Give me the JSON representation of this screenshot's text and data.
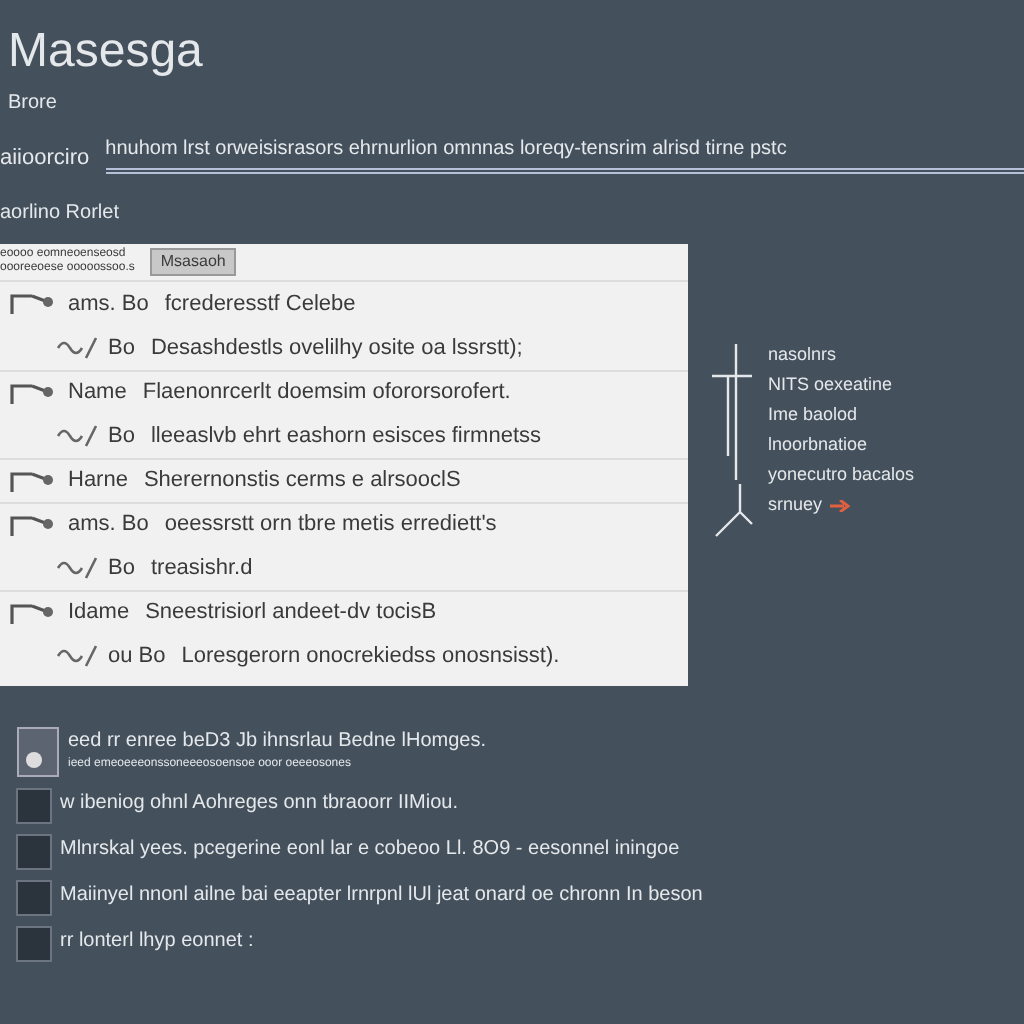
{
  "title": "Masesga",
  "subtitle": "Brore",
  "field": {
    "label": "aiioorciro",
    "value": "hnuhom lrst orweisisrasors ehrnurlion omnnas loreqy-tensrim alrisd tirne pstc"
  },
  "section_label": "aorlino Rorlet",
  "panel": {
    "header_text": "eoooo eomneoenseosd",
    "header_subtext": "oooreeoese ooooossoo.s",
    "tab_label": "Msasaoh",
    "rows": [
      {
        "kind": "main",
        "name": "ams. Bo",
        "text": "fcrederesstf Celebe"
      },
      {
        "kind": "sub",
        "name": "Bo",
        "text": "Desashdestls ovelilhy osite oa lssrstt);"
      },
      {
        "kind": "main",
        "name": "Name",
        "text": "Flaenonrcerlt doemsim ofororsorofert."
      },
      {
        "kind": "sub",
        "name": "Bo",
        "text": "lleeaslvb ehrt eashorn esisces firmnetss"
      },
      {
        "kind": "main",
        "name": "Harne",
        "text": "Sherernonstis cerms e alrsooclS"
      },
      {
        "kind": "main",
        "name": "ams. Bo",
        "text": "oeessrstt orn tbre metis errediett's"
      },
      {
        "kind": "sub",
        "name": "Bo",
        "text": "treasishr.d"
      },
      {
        "kind": "main",
        "name": "Idame",
        "text": "Sneestrisiorl andeet-dv tocisB"
      },
      {
        "kind": "sub",
        "name": "ou Bo",
        "text": "Loresgerorn onocrekiedss onosnsisst)."
      }
    ]
  },
  "notes": [
    {
      "text": "nasolnrs",
      "flagged": false
    },
    {
      "text": "NITS oexeatine",
      "flagged": false
    },
    {
      "text": "Ime baolod",
      "flagged": false
    },
    {
      "text": "lnoorbnatioe",
      "flagged": false
    },
    {
      "text": "yonecutro bacalos",
      "flagged": false
    },
    {
      "text": "srnuey",
      "flagged": true
    }
  ],
  "checklist": [
    {
      "kind": "file",
      "text": "eed rr enree beD3 Jb ihnsrlau Bedne lHomges.",
      "subtext": "ieed emeoeeeonssoneeeosoensoe ooor oeeeosones",
      "checked": false
    },
    {
      "kind": "box",
      "text": "w ibeniog ohnl Aohreges onn tbraoorr IIMiou.",
      "checked": false
    },
    {
      "kind": "box",
      "text": "Mlnrskal yees. pcegerine eonl lar e cobeoo Ll. 8O9 - eesonnel iningoe",
      "checked": false
    },
    {
      "kind": "box",
      "text": "Maiinyel nnonl ailne bai eeapter lrnrpnl lUl jeat onard oe chronn In beson",
      "checked": false
    },
    {
      "kind": "box",
      "text": "rr lonterl lhyp eonnet :",
      "checked": false
    }
  ]
}
